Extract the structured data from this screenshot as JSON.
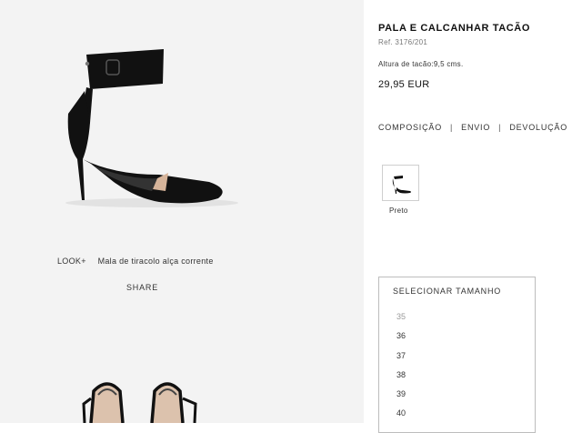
{
  "left": {
    "look_label": "LOOK+",
    "look_item": "Mala de tiracolo alça corrente",
    "share": "SHARE"
  },
  "product": {
    "title": "PALA E CALCANHAR TACÃO",
    "ref": "Ref. 3176/201",
    "heel_height": "Altura de tacão:9,5 cms.",
    "price": "29,95 EUR"
  },
  "info_links": [
    "COMPOSIÇÃO",
    "ENVIO",
    "DEVOLUÇÃO"
  ],
  "info_separator": "|",
  "colors": [
    {
      "label": "Preto",
      "icon": "shoe-thumbnail-icon"
    }
  ],
  "sizes": {
    "title": "SELECIONAR TAMANHO",
    "options": [
      "35",
      "36",
      "37",
      "38",
      "39",
      "40"
    ],
    "unavailable": [
      "35"
    ]
  }
}
